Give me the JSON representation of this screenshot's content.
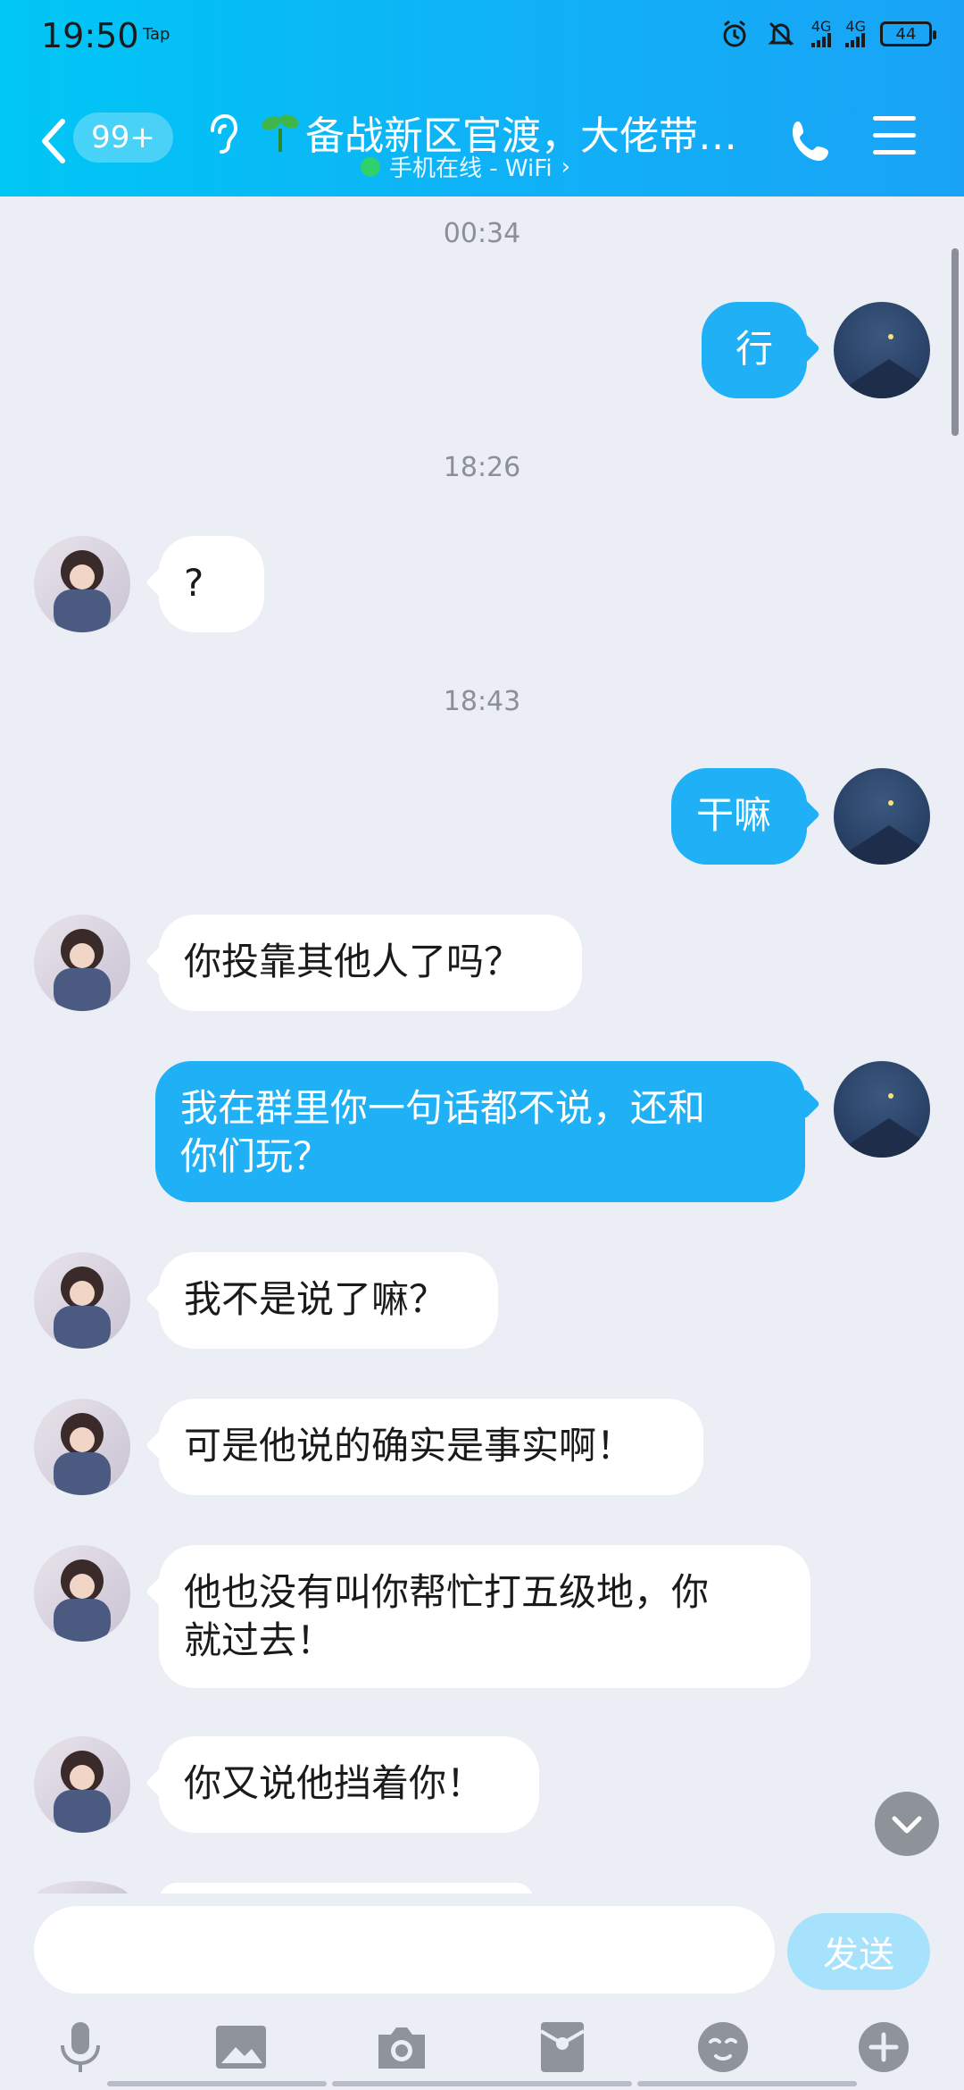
{
  "status_bar": {
    "time": "19:50",
    "tap_label": "Tap",
    "network_1": "4G",
    "network_2": "4G",
    "battery": "44"
  },
  "header": {
    "unread_badge": "99+",
    "title": "备战新区官渡，大佬带…",
    "online_status": "手机在线 - WiFi",
    "online_chevron": "›"
  },
  "messages": [
    {
      "type": "timestamp",
      "text": "00:34"
    },
    {
      "type": "message",
      "from": "me",
      "text": "行"
    },
    {
      "type": "timestamp",
      "text": "18:26"
    },
    {
      "type": "message",
      "from": "other",
      "text": "?"
    },
    {
      "type": "timestamp",
      "text": "18:43"
    },
    {
      "type": "message",
      "from": "me",
      "text": "干嘛"
    },
    {
      "type": "message",
      "from": "other",
      "text": "你投靠其他人了吗？"
    },
    {
      "type": "message",
      "from": "me",
      "line1": "我在群里你一句话都不说，还和",
      "line2": "你们玩？"
    },
    {
      "type": "message",
      "from": "other",
      "text": "我不是说了嘛？"
    },
    {
      "type": "message",
      "from": "other",
      "text": "可是他说的确实是事实啊！"
    },
    {
      "type": "message",
      "from": "other",
      "line1": "他也没有叫你帮忙打五级地，你",
      "line2": "就过去！"
    },
    {
      "type": "message",
      "from": "other",
      "text": "你又说他挡着你！"
    }
  ],
  "composer": {
    "input_value": "",
    "send_label": "发送"
  },
  "toolbar_icons": [
    "microphone-icon",
    "image-icon",
    "camera-icon",
    "red-packet-icon",
    "emoji-icon",
    "plus-icon"
  ],
  "colors": {
    "header_start": "#00c6f5",
    "header_end": "#1aa3f6",
    "my_bubble": "#1fb0f6",
    "chat_background": "#eceef5",
    "send_button": "#a6e2fb",
    "online_dot": "#2ed16a"
  }
}
